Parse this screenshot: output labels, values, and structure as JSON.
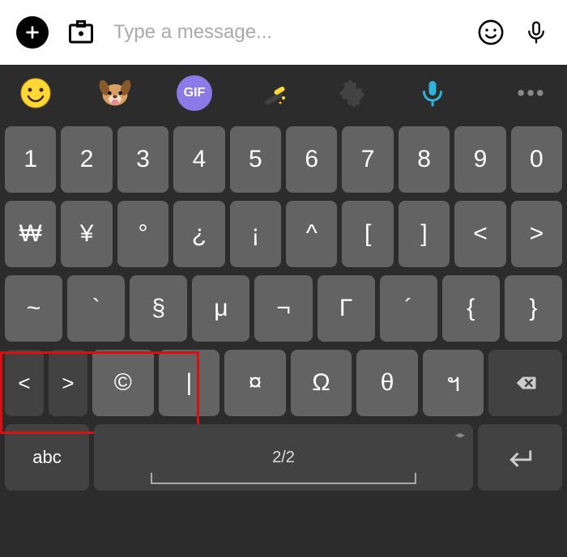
{
  "input": {
    "placeholder": "Type a message...",
    "value": ""
  },
  "toolbar": {
    "gif_label": "GIF",
    "more": "•••"
  },
  "keys": {
    "row1": [
      "1",
      "2",
      "3",
      "4",
      "5",
      "6",
      "7",
      "8",
      "9",
      "0"
    ],
    "row2": [
      "₩",
      "¥",
      "°",
      "¿",
      "¡",
      "^",
      "[",
      "]",
      "<",
      ">"
    ],
    "row3": [
      "~",
      "`",
      "§",
      "μ",
      "¬",
      "Γ",
      "´",
      "{",
      "}"
    ],
    "row4_shift_prev": "<",
    "row4_shift_next": ">",
    "row4_symbols": [
      "©",
      "|",
      "¤",
      "Ω",
      "θ",
      "ฯ"
    ],
    "row5": {
      "abc": "abc",
      "page": "2/2",
      "arrows": "◂▸"
    }
  }
}
